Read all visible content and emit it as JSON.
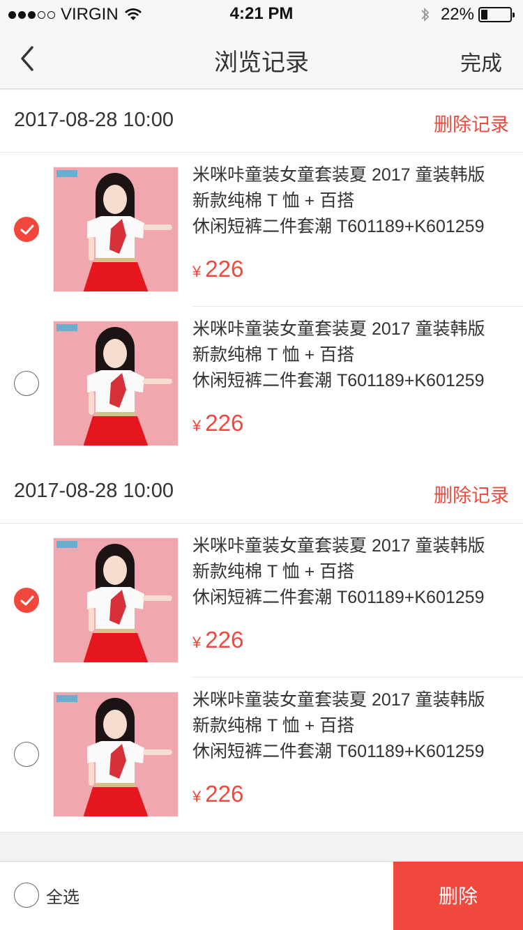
{
  "status": {
    "carrier": "VIRGIN",
    "time": "4:21 PM",
    "battery": "22%",
    "battery_level": 0.22
  },
  "nav": {
    "title": "浏览记录",
    "done": "完成"
  },
  "groups": [
    {
      "date": "2017-08-28 10:00",
      "delete_label": "删除记录",
      "items": [
        {
          "title_line1": "米咪咔童装女童套装夏 2017 童装韩版",
          "title_line2": "新款纯棉 T 恤 + 百搭",
          "title_line3": "休闲短裤二件套潮 T601189+K601259",
          "currency": "¥",
          "price": "226",
          "checked": true
        },
        {
          "title_line1": "米咪咔童装女童套装夏 2017 童装韩版",
          "title_line2": "新款纯棉 T 恤 + 百搭",
          "title_line3": "休闲短裤二件套潮 T601189+K601259",
          "currency": "¥",
          "price": "226",
          "checked": false
        }
      ]
    },
    {
      "date": "2017-08-28 10:00",
      "delete_label": "删除记录",
      "items": [
        {
          "title_line1": "米咪咔童装女童套装夏 2017 童装韩版",
          "title_line2": "新款纯棉 T 恤 + 百搭",
          "title_line3": "休闲短裤二件套潮 T601189+K601259",
          "currency": "¥",
          "price": "226",
          "checked": true
        },
        {
          "title_line1": "米咪咔童装女童套装夏 2017 童装韩版",
          "title_line2": "新款纯棉 T 恤 + 百搭",
          "title_line3": "休闲短裤二件套潮 T601189+K601259",
          "currency": "¥",
          "price": "226",
          "checked": false
        }
      ]
    }
  ],
  "bottom": {
    "select_all": "全选",
    "delete": "删除"
  },
  "colors": {
    "accent": "#f2473c",
    "thumb_bg": "#f0a7ad"
  },
  "icons": {
    "back": "chevron-left-icon",
    "check": "checkmark-icon",
    "wifi": "wifi-icon",
    "bluetooth": "bluetooth-icon",
    "battery": "battery-icon"
  }
}
